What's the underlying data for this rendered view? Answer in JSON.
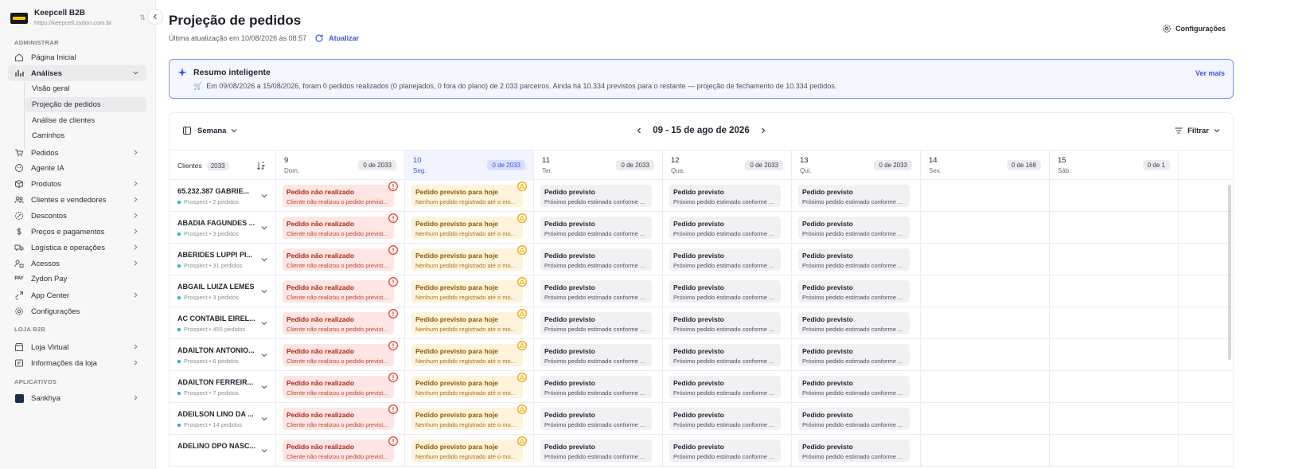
{
  "brand": {
    "name": "Keepcell B2B",
    "url": "https://keepcell.zydon.com.br"
  },
  "sidebar": {
    "section_admin": "ADMINISTRAR",
    "section_store": "LOJA B2B",
    "section_apps": "APLICATIVOS",
    "items": [
      {
        "label": "Página Inicial",
        "icon": "home-icon"
      },
      {
        "label": "Análises",
        "icon": "chart-icon"
      },
      {
        "label": "Pedidos",
        "icon": "cart-icon"
      },
      {
        "label": "Agente IA",
        "icon": "bot-icon"
      },
      {
        "label": "Produtos",
        "icon": "box-icon"
      },
      {
        "label": "Clientes e vendedores",
        "icon": "users-icon"
      },
      {
        "label": "Descontos",
        "icon": "discount-icon"
      },
      {
        "label": "Preços e pagamentos",
        "icon": "dollar-icon"
      },
      {
        "label": "Logística e operações",
        "icon": "truck-icon"
      },
      {
        "label": "Acessos",
        "icon": "access-icon"
      },
      {
        "label": "Zydon Pay",
        "icon": "pay-icon"
      },
      {
        "label": "App Center",
        "icon": "apps-icon"
      },
      {
        "label": "Configurações",
        "icon": "gear-icon"
      },
      {
        "label": "Loja Virtual",
        "icon": "store-icon"
      },
      {
        "label": "Informações da loja",
        "icon": "info-icon"
      },
      {
        "label": "Sankhya",
        "icon": "sankhya-icon"
      }
    ],
    "sub_items": [
      "Visão geral",
      "Projeção de pedidos",
      "Análise de clientes",
      "Carrinhos"
    ]
  },
  "header": {
    "title": "Projeção de pedidos",
    "updated": "Última atualização em 10/08/2026 às 08:57",
    "refresh": "Atualizar",
    "config": "Configurações"
  },
  "summary": {
    "title": "Resumo inteligente",
    "text": "Em 09/08/2026 a 15/08/2026, foram 0 pedidos realizados (0 planejados, 0 fora do plano) de 2.033 parceiros. Ainda há 10.334 previstos para o restante — projeção de fechamento de 10.334 pedidos.",
    "more": "Ver mais"
  },
  "board": {
    "view": "Semana",
    "week": "09 - 15 de ago de 2026",
    "filter": "Filtrar",
    "clients_label": "Clientes",
    "clients_count": "2033",
    "days": [
      {
        "num": "9",
        "name": "Dom.",
        "badge": "0 de 2033"
      },
      {
        "num": "10",
        "name": "Seg.",
        "badge": "0 de 2033"
      },
      {
        "num": "11",
        "name": "Ter.",
        "badge": "0 de 2033"
      },
      {
        "num": "12",
        "name": "Qua.",
        "badge": "0 de 2033"
      },
      {
        "num": "13",
        "name": "Qui.",
        "badge": "0 de 2033"
      },
      {
        "num": "14",
        "name": "Sex.",
        "badge": "0 de 168"
      },
      {
        "num": "15",
        "name": "Sáb.",
        "badge": "0 de 1"
      }
    ],
    "cards": {
      "miss_title": "Pedido não realizado",
      "miss_sub": "Cliente não realizou o pedido previst...",
      "today_title": "Pedido previsto para hoje",
      "today_sub": "Nenhum pedido registrado até o mo...",
      "plan_title": "Pedido previsto",
      "plan_sub": "Próximo pedido estimado conforme ..."
    },
    "rows": [
      {
        "name": "65.232.387 GABRIE...",
        "sub": "Prospect • 2 pedidos"
      },
      {
        "name": "ABADIA FAGUNDES ...",
        "sub": "Prospect • 3 pedidos"
      },
      {
        "name": "ABERIDES LUPPI PI...",
        "sub": "Prospect • 31 pedidos"
      },
      {
        "name": "ABGAIL LUIZA LEMES",
        "sub": "Prospect • 3 pedidos"
      },
      {
        "name": "AC CONTABIL EIREL...",
        "sub": "Prospect • 455 pedidos"
      },
      {
        "name": "ADAILTON ANTONIO...",
        "sub": "Prospect • 6 pedidos"
      },
      {
        "name": "ADAILTON FERREIR...",
        "sub": "Prospect • 7 pedidos"
      },
      {
        "name": "ADEILSON LINO DA ...",
        "sub": "Prospect • 14 pedidos"
      },
      {
        "name": "ADELINO DPO NASC...",
        "sub": ""
      }
    ]
  }
}
